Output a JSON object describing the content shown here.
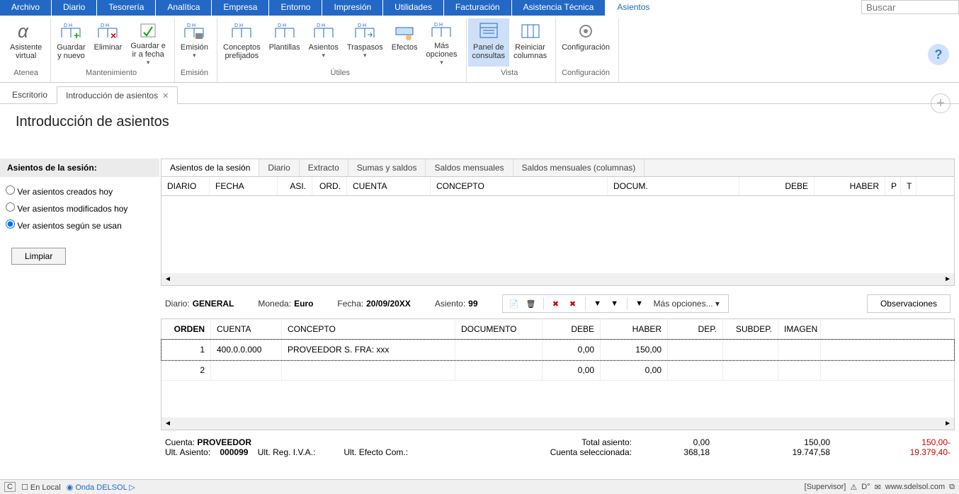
{
  "menu": [
    "Archivo",
    "Diario",
    "Tesorería",
    "Analítica",
    "Empresa",
    "Entorno",
    "Impresión",
    "Utilidades",
    "Facturación",
    "Asistencia Técnica",
    "Asientos"
  ],
  "menu_active": 10,
  "search_placeholder": "Buscar",
  "ribbon": {
    "groups": [
      {
        "label": "Atenea",
        "items": [
          {
            "name": "asistente",
            "lbl": "Asistente\nvirtual"
          }
        ]
      },
      {
        "label": "Mantenimiento",
        "items": [
          {
            "name": "guardar-nuevo",
            "lbl": "Guardar\ny nuevo"
          },
          {
            "name": "eliminar",
            "lbl": "Eliminar"
          },
          {
            "name": "guardar-fecha",
            "lbl": "Guardar e\nir a fecha",
            "dd": true
          }
        ]
      },
      {
        "label": "Emisión",
        "items": [
          {
            "name": "emision",
            "lbl": "Emisión",
            "dd": true
          }
        ]
      },
      {
        "label": "Útiles",
        "items": [
          {
            "name": "conceptos",
            "lbl": "Conceptos\nprefijados"
          },
          {
            "name": "plantillas",
            "lbl": "Plantillas"
          },
          {
            "name": "asientos-btn",
            "lbl": "Asientos",
            "dd": true
          },
          {
            "name": "traspasos",
            "lbl": "Traspasos",
            "dd": true
          },
          {
            "name": "efectos",
            "lbl": "Efectos"
          },
          {
            "name": "mas-opc",
            "lbl": "Más\nopciones",
            "dd": true
          }
        ]
      },
      {
        "label": "Vista",
        "items": [
          {
            "name": "panel-consultas",
            "lbl": "Panel de\nconsultas",
            "sel": true
          },
          {
            "name": "reiniciar-col",
            "lbl": "Reiniciar\ncolumnas"
          }
        ]
      },
      {
        "label": "Configuración",
        "items": [
          {
            "name": "config",
            "lbl": "Configuración"
          }
        ]
      }
    ]
  },
  "tabs": [
    {
      "label": "Escritorio"
    },
    {
      "label": "Introducción de asientos",
      "active": true,
      "closable": true
    }
  ],
  "page_title": "Introducción de asientos",
  "leftpanel": {
    "header": "Asientos de la sesión:",
    "options": [
      "Ver asientos creados hoy",
      "Ver asientos modificados hoy",
      "Ver asientos según se usan"
    ],
    "selected": 2,
    "clear": "Limpiar"
  },
  "innertabs": [
    "Asientos de la sesión",
    "Diario",
    "Extracto",
    "Sumas y saldos",
    "Saldos mensuales",
    "Saldos mensuales (columnas)"
  ],
  "grid1_head": [
    "DIARIO",
    "FECHA",
    "ASI.",
    "ORD.",
    "CUENTA",
    "CONCEPTO",
    "DOCUM.",
    "DEBE",
    "HABER",
    "P",
    "T"
  ],
  "form": {
    "diario_lbl": "Diario:",
    "diario": "GENERAL",
    "moneda_lbl": "Moneda:",
    "moneda": "Euro",
    "fecha_lbl": "Fecha:",
    "fecha": "20/09/20XX",
    "asiento_lbl": "Asiento:",
    "asiento": "99",
    "more": "Más opciones...",
    "obs": "Observaciones"
  },
  "grid2_head": [
    "ORDEN",
    "CUENTA",
    "CONCEPTO",
    "DOCUMENTO",
    "DEBE",
    "HABER",
    "DEP.",
    "SUBDEP.",
    "IMAGEN"
  ],
  "grid2_rows": [
    {
      "orden": "1",
      "cuenta": "400.0.0.000",
      "concepto": "PROVEEDOR S. FRA:  xxx",
      "doc": "",
      "debe": "0,00",
      "haber": "150,00",
      "sel": true
    },
    {
      "orden": "2",
      "cuenta": "",
      "concepto": "",
      "doc": "",
      "debe": "0,00",
      "haber": "0,00"
    }
  ],
  "footer": {
    "cuenta_lbl": "Cuenta:",
    "cuenta": "PROVEEDOR",
    "ult_asiento_lbl": "Ult. Asiento:",
    "ult_asiento": "000099",
    "ult_reg_lbl": "Ult. Reg. I.V.A.:",
    "ult_ef_lbl": "Ult. Efecto Com.:",
    "total_lbl": "Total asiento:",
    "cuenta_sel_lbl": "Cuenta seleccionada:",
    "col1": [
      "0,00",
      "368,18"
    ],
    "col2": [
      "150,00",
      "19.747,58"
    ],
    "col3": [
      "150,00-",
      "19.379,40-"
    ]
  },
  "statusbar": {
    "c": "C",
    "local": "En Local",
    "onda": "Onda DELSOL",
    "sup": "[Supervisor]",
    "site": "www.sdelsol.com"
  }
}
